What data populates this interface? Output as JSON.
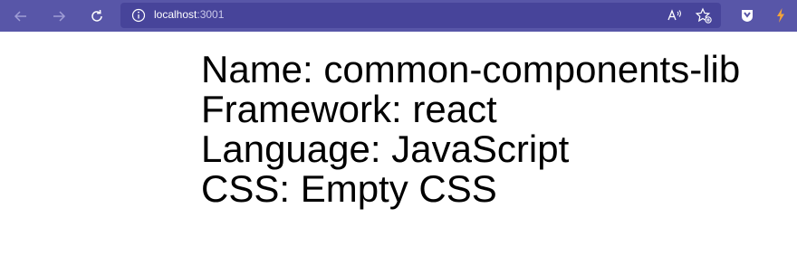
{
  "browser": {
    "address": {
      "host": "localhost",
      "port": ":3001"
    },
    "icons": {
      "back": "arrow-left-icon",
      "forward": "arrow-right-icon",
      "reload": "reload-icon",
      "site_info": "info-icon",
      "read_aloud": "read-aloud-icon",
      "favorites": "favorites-icon",
      "extension_shield": "shield-extension-icon",
      "extension_bolt": "bolt-extension-icon"
    },
    "colors": {
      "toolbar": "#5856a8",
      "address_bar": "#47449a",
      "bolt": "#f2a33a"
    }
  },
  "page": {
    "lines": [
      "Name: common-components-lib",
      "Framework: react",
      "Language: JavaScript",
      "CSS: Empty CSS"
    ]
  }
}
